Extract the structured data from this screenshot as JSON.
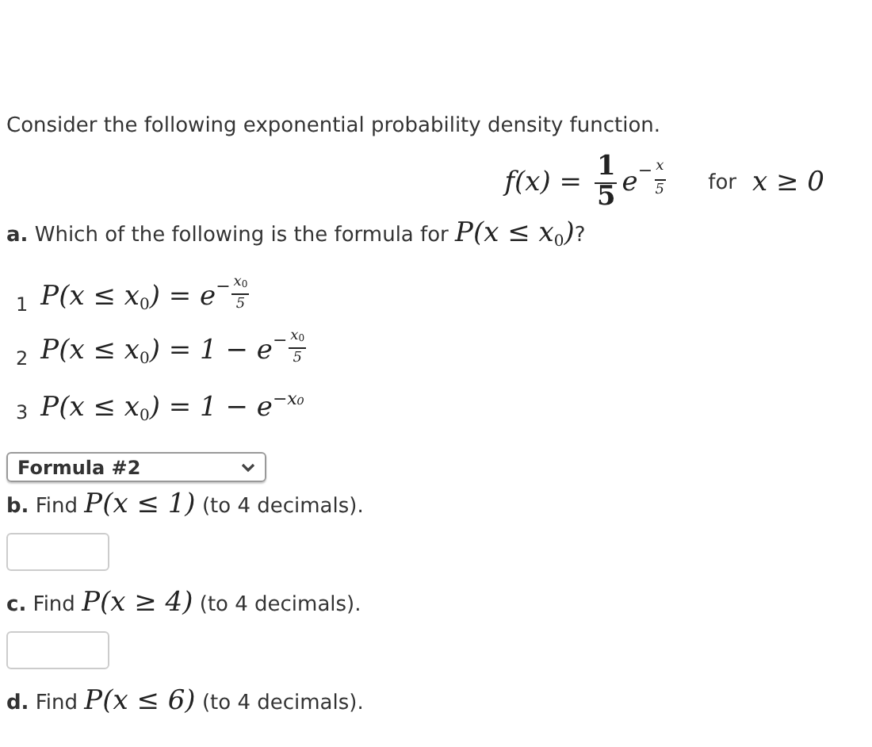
{
  "intro": "Consider the following exponential probability density function.",
  "density": {
    "formula": [
      {
        "kind": "text",
        "text": "f(x) = "
      },
      {
        "kind": "frac",
        "num": "1",
        "den": "5"
      },
      {
        "kind": "power",
        "base": "e",
        "exp": [
          {
            "kind": "text",
            "text": "−"
          },
          {
            "kind": "frac",
            "num": "x",
            "den": "5"
          }
        ]
      }
    ],
    "condition_label": "for",
    "condition": [
      {
        "kind": "text",
        "text": "x ≥ 0"
      }
    ]
  },
  "questions": [
    {
      "label": "a.",
      "parts": [
        {
          "kind": "text",
          "text": "Which of the following is the formula for "
        },
        {
          "kind": "math",
          "math": [
            {
              "kind": "text",
              "text": "P(x ≤ x$_{0}$)"
            }
          ]
        },
        {
          "kind": "text",
          "text": "?"
        }
      ],
      "answer": {
        "kind": "options",
        "options": [
          {
            "number": "1",
            "formula": [
              {
                "kind": "text",
                "text": "P(x ≤ x$_{0}$) = "
              },
              {
                "kind": "power",
                "base": "e",
                "exp": [
                  {
                    "kind": "text",
                    "text": "−"
                  },
                  {
                    "kind": "frac",
                    "num": "x$_{0}$",
                    "den": "5"
                  }
                ]
              }
            ]
          },
          {
            "number": "2",
            "formula": [
              {
                "kind": "text",
                "text": "P(x ≤ x$_{0}$) = 1 − "
              },
              {
                "kind": "power",
                "base": "e",
                "exp": [
                  {
                    "kind": "text",
                    "text": "−"
                  },
                  {
                    "kind": "frac",
                    "num": "x$_{0}$",
                    "den": "5"
                  }
                ]
              }
            ]
          },
          {
            "number": "3",
            "formula": [
              {
                "kind": "text",
                "text": "P(x ≤ x$_{0}$) = 1 − e$^{−x₀}$"
              }
            ]
          }
        ],
        "select": {
          "value": "Formula #2"
        }
      }
    },
    {
      "label": "b.",
      "parts": [
        {
          "kind": "text",
          "text": "Find "
        },
        {
          "kind": "math",
          "math": [
            {
              "kind": "text",
              "text": "P(x ≤ 1)"
            }
          ]
        },
        {
          "kind": "text",
          "text": " (to 4 decimals)."
        }
      ],
      "answer": {
        "kind": "input"
      }
    },
    {
      "label": "c.",
      "parts": [
        {
          "kind": "text",
          "text": "Find "
        },
        {
          "kind": "math",
          "math": [
            {
              "kind": "text",
              "text": "P(x ≥ 4)"
            }
          ]
        },
        {
          "kind": "text",
          "text": " (to 4 decimals)."
        }
      ],
      "answer": {
        "kind": "input"
      }
    },
    {
      "label": "d.",
      "parts": [
        {
          "kind": "text",
          "text": "Find "
        },
        {
          "kind": "math",
          "math": [
            {
              "kind": "text",
              "text": "P(x ≤ 6)"
            }
          ]
        },
        {
          "kind": "text",
          "text": " (to 4 decimals)."
        }
      ],
      "answer": {
        "kind": "none"
      }
    }
  ]
}
